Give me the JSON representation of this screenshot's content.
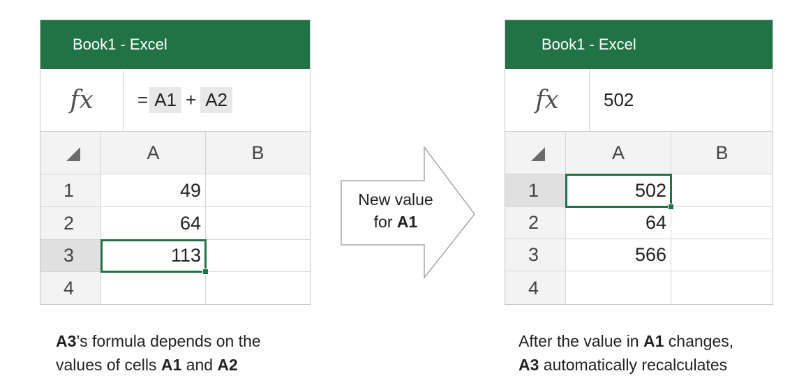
{
  "left": {
    "title": "Book1 - Excel",
    "fx": "fx",
    "formula": {
      "eq": "=",
      "ref1": "A1",
      "op": "+",
      "ref2": "A2"
    },
    "col_a": "A",
    "col_b": "B",
    "rows": [
      {
        "num": "1",
        "a": "49"
      },
      {
        "num": "2",
        "a": "64"
      },
      {
        "num": "3",
        "a": "113"
      },
      {
        "num": "4",
        "a": ""
      }
    ]
  },
  "arrow": {
    "line1": "New value",
    "line2_pre": "for ",
    "line2_bold": "A1"
  },
  "right": {
    "title": "Book1 - Excel",
    "fx": "fx",
    "formula_value": "502",
    "col_a": "A",
    "col_b": "B",
    "rows": [
      {
        "num": "1",
        "a": "502"
      },
      {
        "num": "2",
        "a": "64"
      },
      {
        "num": "3",
        "a": "566"
      },
      {
        "num": "4",
        "a": ""
      }
    ]
  },
  "captions": {
    "left_l1_bold": "A3",
    "left_l1_rest": "’s formula depends on the",
    "left_l2_pre": "values of cells ",
    "left_l2_b1": "A1",
    "left_l2_mid": " and ",
    "left_l2_b2": "A2",
    "right_l1_pre": "After the value in ",
    "right_l1_bold": "A1",
    "right_l1_rest": " changes,",
    "right_l2_bold": "A3",
    "right_l2_rest": " automatically recalculates"
  },
  "colors": {
    "excel_green": "#217346",
    "header_gray": "#f3f3f3"
  }
}
